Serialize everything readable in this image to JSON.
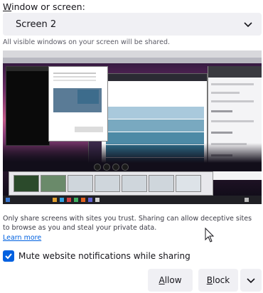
{
  "header": {
    "window_label": "Window or screen:",
    "window_label_access": "W",
    "window_label_rest": "indow or screen:",
    "hint": "All visible windows on your screen will be shared."
  },
  "screen_select": {
    "selected": "Screen 2",
    "icon": "chevron-down-icon"
  },
  "notice": {
    "text": "Only share screens with sites you trust. Sharing can allow deceptive sites to browse as you and steal your private data.",
    "learn_more": "Learn more"
  },
  "mute": {
    "checked": true,
    "label": "Mute website notifications while sharing"
  },
  "buttons": {
    "allow_access": "A",
    "allow_rest": "llow",
    "block_access": "B",
    "block_rest": "lock",
    "dropdown_icon": "chevron-down-icon"
  },
  "colors": {
    "accent": "#0061e0",
    "button_bg": "#f0f0f4",
    "text": "#15141a",
    "muted": "#5b5b66",
    "stripes": [
      "#a9c9dc",
      "#79a9c0",
      "#4c8aa6",
      "#2d6d8a",
      "#245b74"
    ]
  }
}
